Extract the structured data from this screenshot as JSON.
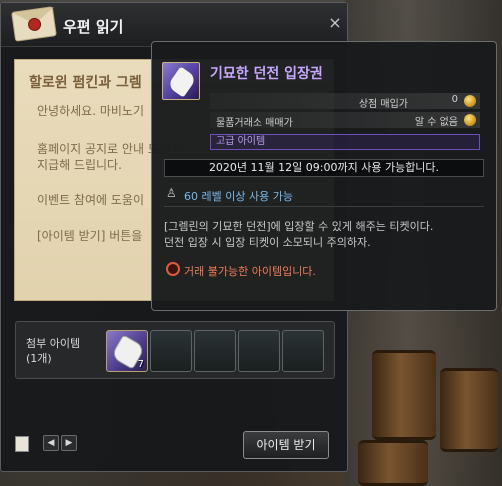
{
  "mail_window": {
    "title": "우편 읽기",
    "close_label": "×",
    "letter": {
      "title": "할로윈 펌킨과 그렘",
      "lines": [
        "안녕하세요. 마비노기",
        "홈페이지 공지로 안내 드린 기",
        "지급해 드립니다.",
        "이벤트 참여에 도움이",
        "[아이템 받기] 버튼을"
      ]
    },
    "attachment": {
      "label": "첨부 아이템",
      "count": "(1개)",
      "first_slot_qty": "7"
    },
    "receive_button": "아이템 받기",
    "nav_prev": "◀",
    "nav_next": "▶"
  },
  "tooltip": {
    "item_name": "기묘한 던전 입장권",
    "shop_price_label": "상점 매입가",
    "shop_price_value": "0",
    "market_price_label": "물품거래소 매매가",
    "market_price_value": "알 수 없음",
    "grade": "고급 아이템",
    "expiry": "2020년 11월 12일 09:00까지 사용 가능합니다.",
    "level_req": "60 레벨 이상 사용 가능",
    "description": [
      "[그렘린의 기묘한 던전]에 입장할 수 있게 해주는 티켓이다.",
      "던전 입장 시 입장 티켓이 소모되니 주의하자."
    ],
    "trade_status": "거래 불가능한 아이템입니다."
  },
  "colors": {
    "item_name": "#c8a8ff",
    "grade": "#b69cf0",
    "level": "#7ab8e8",
    "trade_warning": "#f07a58"
  },
  "icons": {
    "mail": "envelope-icon",
    "coin": "gold-coin-icon",
    "level": "person-icon",
    "trade": "no-trade-icon"
  }
}
